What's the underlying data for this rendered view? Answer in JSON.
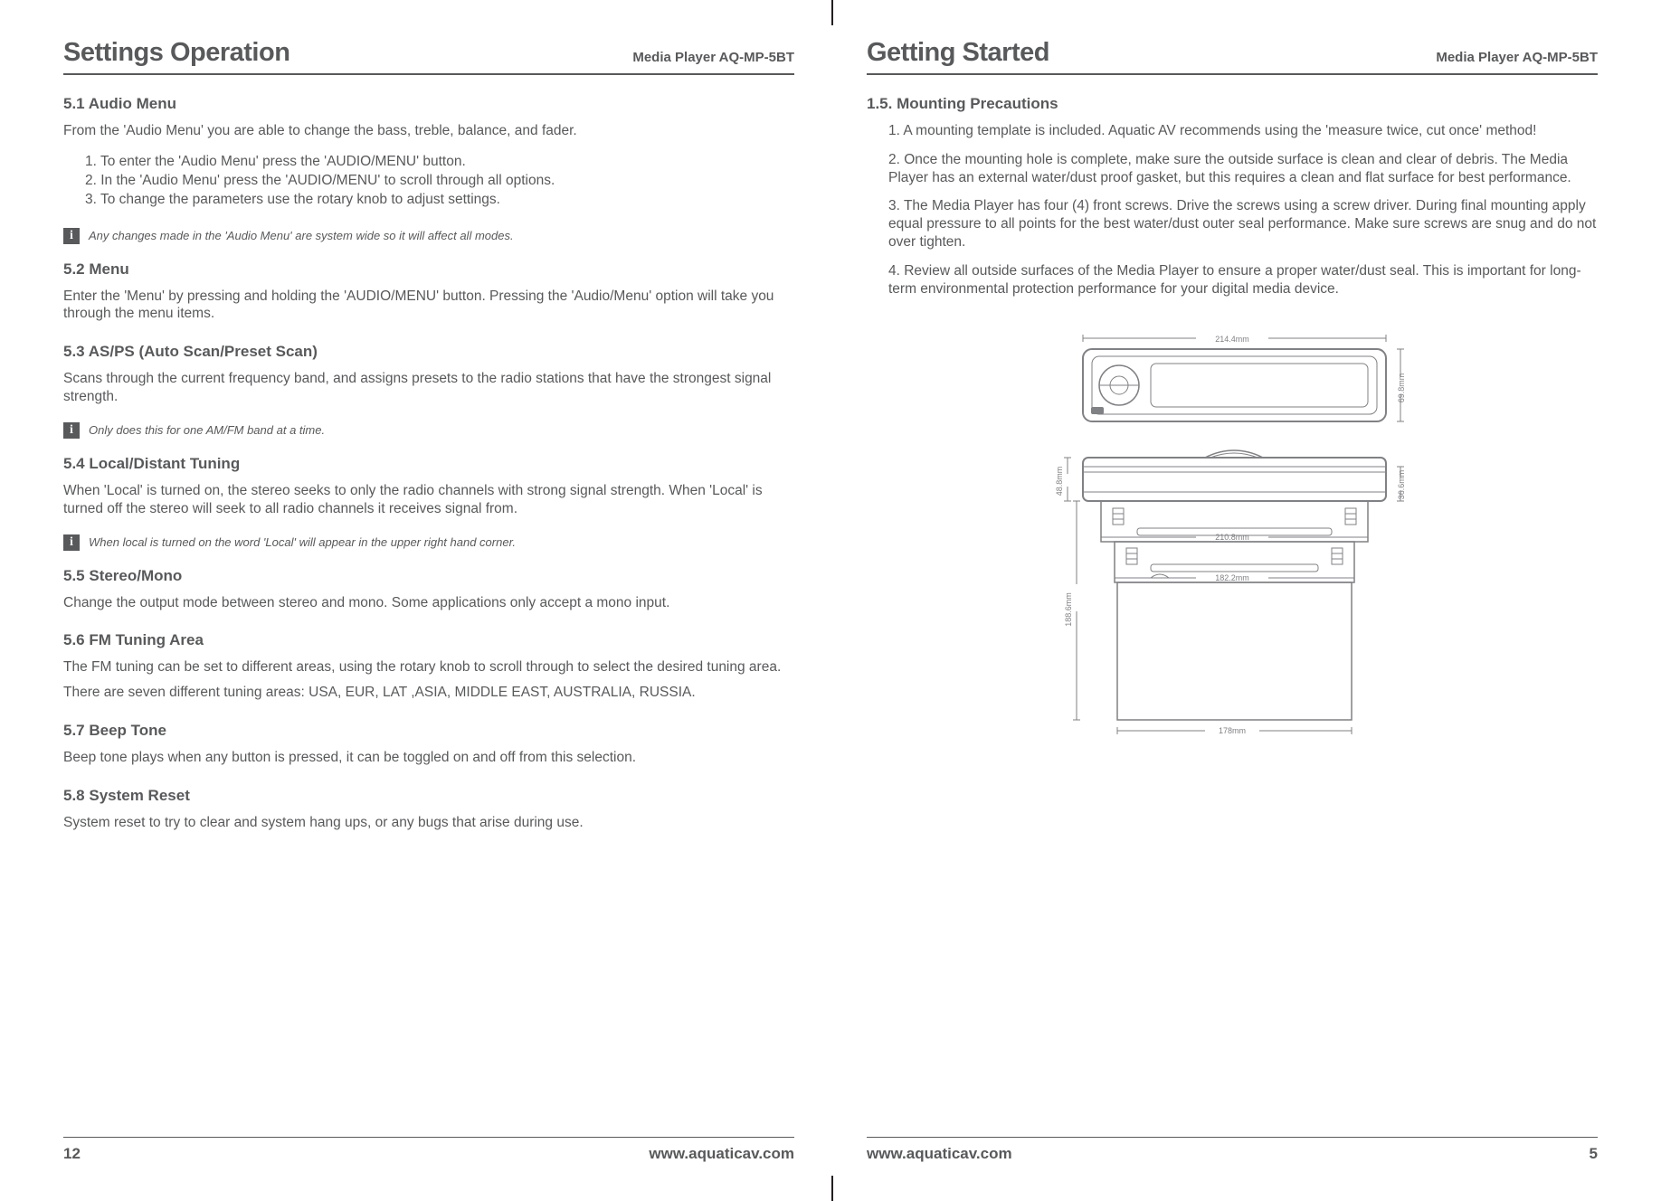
{
  "left": {
    "title": "Settings Operation",
    "model": "Media Player AQ-MP-5BT",
    "s51": {
      "h": "5.1 Audio Menu",
      "intro": "From the 'Audio Menu' you are able to change the bass, treble, balance, and fader.",
      "li1": "1. To enter the 'Audio Menu' press the 'AUDIO/MENU' button.",
      "li2": "2. In the 'Audio Menu' press the 'AUDIO/MENU' to scroll through all options.",
      "li3": "3. To change the parameters use the rotary knob to adjust settings.",
      "note": "Any changes made in the 'Audio Menu' are system wide so it will affect all modes."
    },
    "s52": {
      "h": "5.2 Menu",
      "p": "Enter the 'Menu' by pressing and holding the 'AUDIO/MENU' button.  Pressing the 'Audio/Menu' option will take you through the menu items."
    },
    "s53": {
      "h": "5.3 AS/PS (Auto Scan/Preset Scan)",
      "p": "Scans through the current frequency band, and assigns presets to the radio stations that have the strongest signal strength.",
      "note": "Only does this for one AM/FM band at a time."
    },
    "s54": {
      "h": "5.4 Local/Distant Tuning",
      "p": "When 'Local' is turned on, the stereo seeks to only the radio channels with strong signal strength. When 'Local' is turned off the stereo will seek to all radio channels it receives signal from.",
      "note": "When local is turned on the word 'Local' will appear in the upper right hand corner."
    },
    "s55": {
      "h": "5.5 Stereo/Mono",
      "p": "Change the output mode between stereo and mono. Some applications only accept a mono input."
    },
    "s56": {
      "h": "5.6 FM Tuning Area",
      "p1": "The FM tuning can be set to different areas, using the rotary knob to scroll through to select the desired tuning area.",
      "p2": "There are seven different tuning areas: USA, EUR, LAT ,ASIA, MIDDLE EAST, AUSTRALIA, RUSSIA."
    },
    "s57": {
      "h": "5.7 Beep Tone",
      "p": "Beep tone plays when any button is pressed, it can be toggled on and off from this selection."
    },
    "s58": {
      "h": "5.8 System Reset",
      "p": "System reset to try to clear and system hang ups, or any bugs that arise during use."
    },
    "footer": {
      "page": "12",
      "url": "www.aquaticav.com"
    }
  },
  "right": {
    "title": "Getting Started",
    "model": "Media Player AQ-MP-5BT",
    "s15": {
      "h": "1.5. Mounting Precautions",
      "p1": "1. A mounting template is included. Aquatic AV recommends using the 'measure twice, cut once' method!",
      "p2": "2. Once the mounting hole is complete, make sure the outside surface is clean and clear of debris. The Media Player has an external water/dust proof gasket, but this requires a clean and flat surface for best performance.",
      "p3": "3. The Media Player has four (4) front screws. Drive the screws using a screw driver. During final mounting apply equal pressure to all points for the best water/dust outer seal performance. Make sure screws are snug and do not over tighten.",
      "p4": "4. Review all outside surfaces of the Media Player to ensure a proper water/dust seal. This is important for long-term environmental protection performance for your digital media device."
    },
    "dims": {
      "w_front": "214.4mm",
      "h_front": "69.8mm",
      "w_mid": "210.8mm",
      "w_inner": "182.2mm",
      "w_base": "178mm",
      "h_top": "48.8mm",
      "h_side": "188.6mm",
      "h_lip": "36.6mm"
    },
    "footer": {
      "page": "5",
      "url": "www.aquaticav.com"
    }
  },
  "info_glyph": "i"
}
